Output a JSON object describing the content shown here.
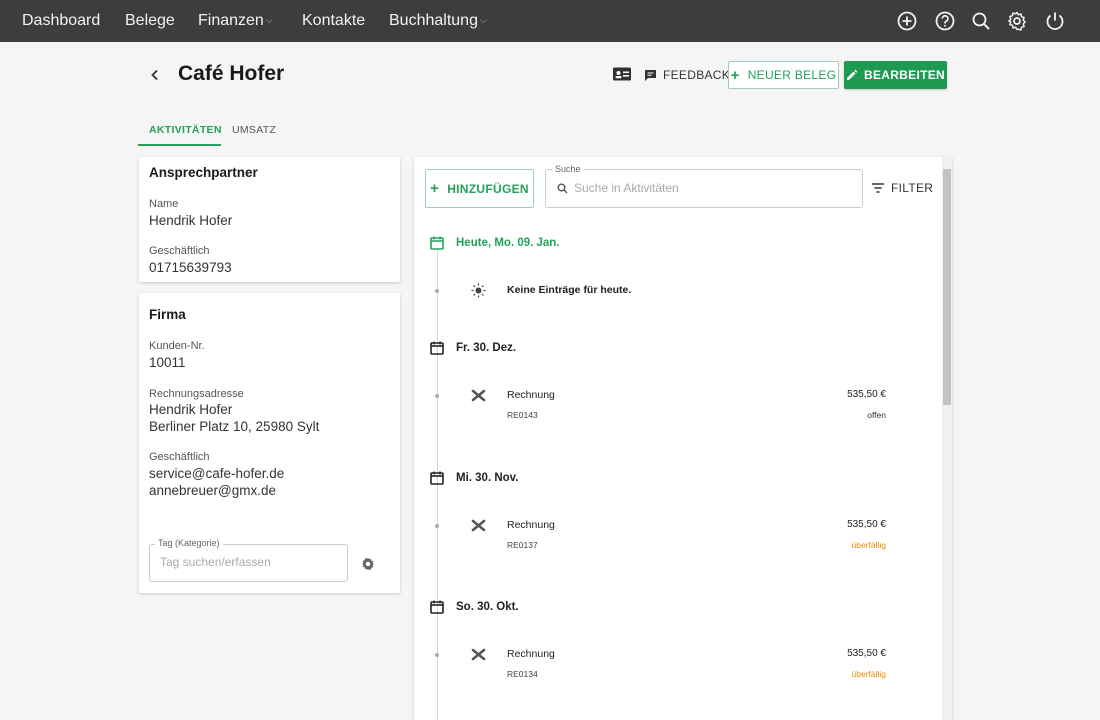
{
  "nav": {
    "items": [
      {
        "label": "Dashboard"
      },
      {
        "label": "Belege"
      },
      {
        "label": "Finanzen",
        "has_dropdown": true
      },
      {
        "label": "Kontakte"
      },
      {
        "label": "Buchhaltung",
        "has_dropdown": true
      }
    ],
    "icons": [
      "add-circle-icon",
      "help-icon",
      "search-icon",
      "gear-icon",
      "power-icon"
    ]
  },
  "header": {
    "title": "Café Hofer",
    "feedback_label": "FEEDBACK",
    "neuer_beleg_label": "NEUER BELEG",
    "bearbeiten_label": "BEARBEITEN"
  },
  "tabs": [
    {
      "label": "AKTIVITÄTEN",
      "active": true
    },
    {
      "label": "UMSATZ",
      "active": false
    }
  ],
  "ansprechpartner": {
    "title": "Ansprechpartner",
    "name_label": "Name",
    "name_value": "Hendrik Hofer",
    "phone_label": "Geschäftlich",
    "phone_value": "01715639793"
  },
  "firma": {
    "title": "Firma",
    "kunden_label": "Kunden-Nr.",
    "kunden_value": "10011",
    "adresse_label": "Rechnungsadresse",
    "adresse_line1": "Hendrik Hofer",
    "adresse_line2": "Berliner Platz 10, 25980 Sylt",
    "email_label": "Geschäftlich",
    "email_1": "service@cafe-hofer.de",
    "email_2": "annebreuer@gmx.de",
    "tag_label": "Tag (Kategorie)",
    "tag_placeholder": "Tag suchen/erfassen"
  },
  "activities": {
    "add_label": "HINZUFÜGEN",
    "search_label": "Suche",
    "search_placeholder": "Suche in Aktivitäten",
    "filter_label": "FILTER",
    "groups": [
      {
        "date": "Heute, Mo. 09. Jan.",
        "today": true,
        "empty_text": "Keine Einträge für heute."
      },
      {
        "date": "Fr. 30. Dez.",
        "entry": {
          "title": "Rechnung",
          "number": "RE0143",
          "amount": "535,50 €",
          "status": "offen",
          "status_color": "#333333"
        }
      },
      {
        "date": "Mi. 30. Nov.",
        "entry": {
          "title": "Rechnung",
          "number": "RE0137",
          "amount": "535,50 €",
          "status": "überfällig",
          "status_color": "#f08c00"
        }
      },
      {
        "date": "So. 30. Okt.",
        "entry": {
          "title": "Rechnung",
          "number": "RE0134",
          "amount": "535,50 €",
          "status": "überfällig",
          "status_color": "#f08c00"
        }
      }
    ]
  },
  "colors": {
    "nav_bg": "#3d3d3d",
    "accent": "#23a05a",
    "primary_button": "#1f9a52",
    "overdue": "#f08c00"
  }
}
